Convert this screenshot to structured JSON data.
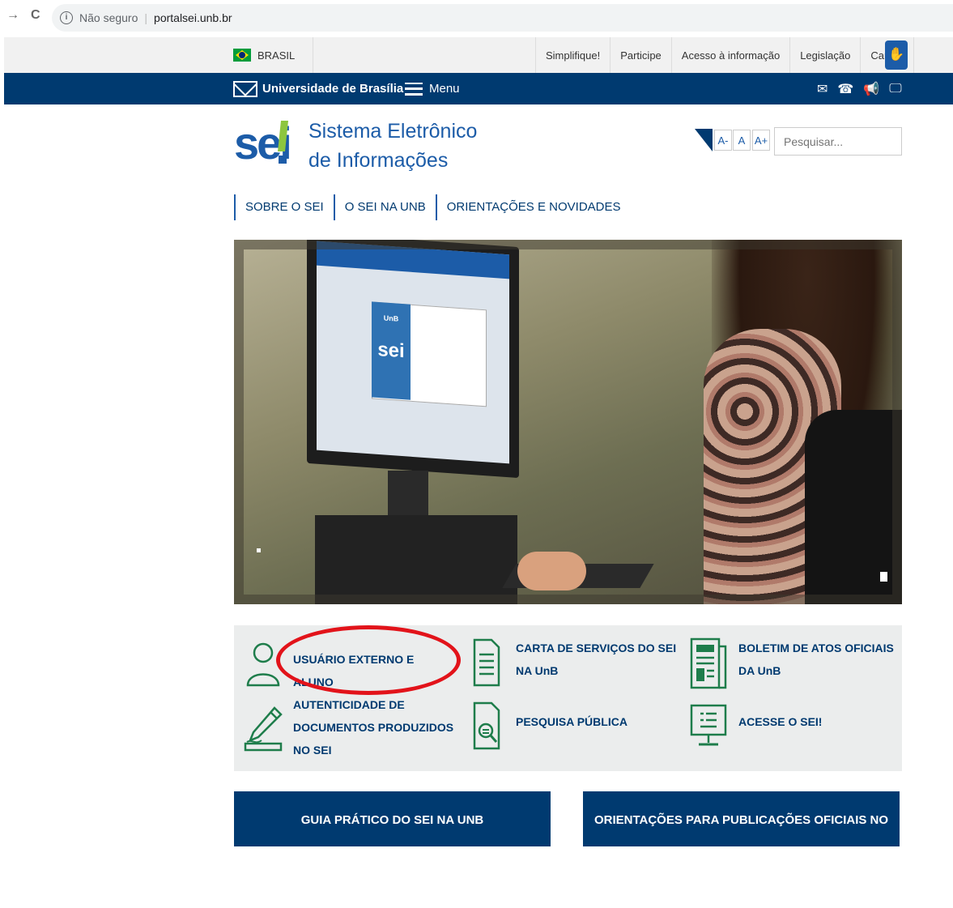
{
  "browser": {
    "security_label": "Não seguro",
    "url": "portalsei.unb.br"
  },
  "govbar": {
    "country": "BRASIL",
    "links": [
      "Simplifique!",
      "Participe",
      "Acesso à informação",
      "Legislação",
      "Canais"
    ]
  },
  "navbar": {
    "university": "Universidade de Brasília",
    "menu_label": "Menu"
  },
  "header": {
    "logo_text": "sei",
    "title_line1": "Sistema Eletrônico",
    "title_line2": "de Informações",
    "font_small": "A-",
    "font_normal": "A",
    "font_large": "A+",
    "search_placeholder": "Pesquisar..."
  },
  "section_nav": [
    "SOBRE O SEI",
    "O SEI NA UNB",
    "ORIENTAÇÕES E NOVIDADES"
  ],
  "hero": {
    "screen_logo_small": "UnB",
    "screen_logo": "sei"
  },
  "services": [
    {
      "label": "USUÁRIO EXTERNO E ALUNO",
      "icon": "user-icon"
    },
    {
      "label": "CARTA DE SERVIÇOS DO SEI NA UnB",
      "icon": "document-list-icon"
    },
    {
      "label": "BOLETIM DE ATOS OFICIAIS DA UnB",
      "icon": "newspaper-icon"
    },
    {
      "label": "AUTENTICIDADE DE DOCUMENTOS PRODUZIDOS NO SEI",
      "icon": "signature-pen-icon"
    },
    {
      "label": "PESQUISA PÚBLICA",
      "icon": "document-search-icon"
    },
    {
      "label": "ACESSE O SEI!",
      "icon": "monitor-icon"
    }
  ],
  "buttons": {
    "guide": "GUIA PRÁTICO DO SEI NA UNB",
    "publications": "ORIENTAÇÕES PARA PUBLICAÇÕES OFICIAIS NO SEI"
  },
  "colors": {
    "navy": "#003a70",
    "brand_blue": "#1c5ca8",
    "green_accent": "#8dc63f",
    "icon_green": "#1e7d4b",
    "highlight_red": "#e2131a"
  }
}
